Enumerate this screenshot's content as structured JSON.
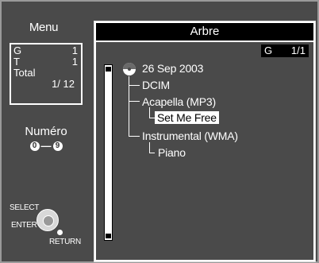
{
  "menu": {
    "title": "Menu",
    "group_label": "G",
    "group_value": "1",
    "track_label": "T",
    "track_value": "1",
    "total_label": "Total",
    "total_value": "1/ 12",
    "numero_label": "Numéro",
    "numero_from": "0",
    "numero_to": "9",
    "select_label": "SELECT",
    "enter_label": "ENTER",
    "return_label": "RETURN"
  },
  "tree": {
    "title": "Arbre",
    "group_prefix": "G",
    "group_page": "1/1",
    "disc_label": "26 Sep 2003",
    "folders": [
      {
        "label": "DCIM"
      },
      {
        "label": "Acapella (MP3)"
      },
      {
        "label": "Set Me Free",
        "selected": true
      },
      {
        "label": "Instrumental (WMA)"
      },
      {
        "label": "Piano"
      }
    ]
  }
}
